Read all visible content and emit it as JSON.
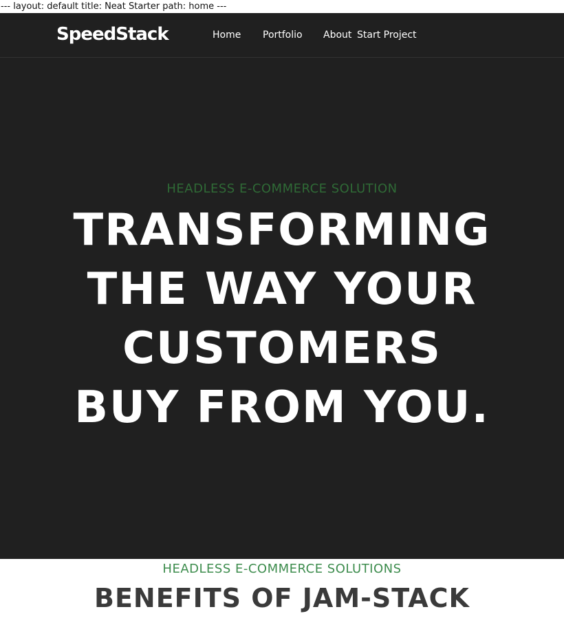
{
  "frontmatter": {
    "text": "--- layout: default title: Neat Starter path: home ---"
  },
  "header": {
    "logo": "SpeedStack",
    "nav": {
      "home": "Home",
      "portfolio": "Portfolio",
      "about": "About",
      "start_project": "Start Project"
    }
  },
  "hero": {
    "eyebrow": "HEADLESS E-COMMERCE SOLUTION",
    "title": "TRANSFORMING THE WAY YOUR CUSTOMERS BUY FROM YOU."
  },
  "benefits": {
    "eyebrow": "HEADLESS E-COMMERCE SOLUTIONS",
    "title": "BENEFITS OF JAM-STACK"
  },
  "colors": {
    "dark_background": "#202020",
    "accent_green": "#3d8c4d",
    "hero_eyebrow_green": "#2f6a36",
    "heading_gray": "#3a3a3a"
  }
}
